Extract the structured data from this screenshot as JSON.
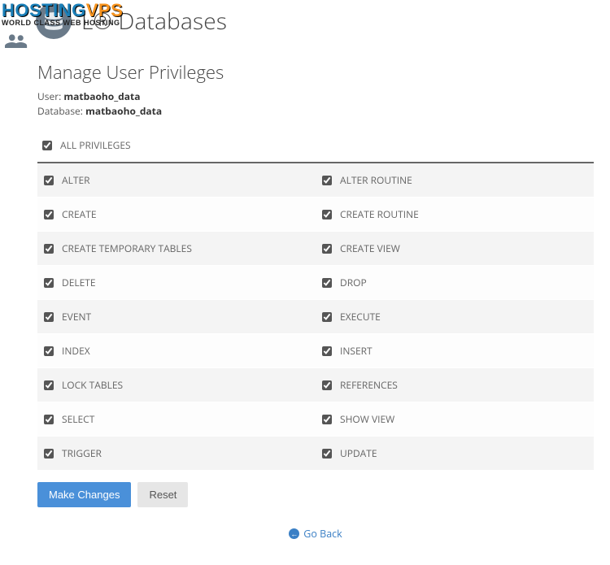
{
  "watermark": {
    "brand_left": "HOSTING",
    "brand_right": "VPS",
    "tag": "WORLD CLASS WEB HOSTING"
  },
  "header": {
    "title_suffix": "L® Databases"
  },
  "section": {
    "title": "Manage User Privileges",
    "user_label": "User: ",
    "user_value": "matbaoho_data",
    "db_label": "Database: ",
    "db_value": "matbaoho_data"
  },
  "all_privileges": {
    "label": "ALL PRIVILEGES",
    "checked": true
  },
  "privileges": [
    {
      "left": {
        "label": "ALTER",
        "checked": true
      },
      "right": {
        "label": "ALTER ROUTINE",
        "checked": true
      }
    },
    {
      "left": {
        "label": "CREATE",
        "checked": true
      },
      "right": {
        "label": "CREATE ROUTINE",
        "checked": true
      }
    },
    {
      "left": {
        "label": "CREATE TEMPORARY TABLES",
        "checked": true
      },
      "right": {
        "label": "CREATE VIEW",
        "checked": true
      }
    },
    {
      "left": {
        "label": "DELETE",
        "checked": true
      },
      "right": {
        "label": "DROP",
        "checked": true
      }
    },
    {
      "left": {
        "label": "EVENT",
        "checked": true
      },
      "right": {
        "label": "EXECUTE",
        "checked": true
      }
    },
    {
      "left": {
        "label": "INDEX",
        "checked": true
      },
      "right": {
        "label": "INSERT",
        "checked": true
      }
    },
    {
      "left": {
        "label": "LOCK TABLES",
        "checked": true
      },
      "right": {
        "label": "REFERENCES",
        "checked": true
      }
    },
    {
      "left": {
        "label": "SELECT",
        "checked": true
      },
      "right": {
        "label": "SHOW VIEW",
        "checked": true
      }
    },
    {
      "left": {
        "label": "TRIGGER",
        "checked": true
      },
      "right": {
        "label": "UPDATE",
        "checked": true
      }
    }
  ],
  "actions": {
    "primary": "Make Changes",
    "reset": "Reset"
  },
  "goback": {
    "label": "Go Back"
  }
}
